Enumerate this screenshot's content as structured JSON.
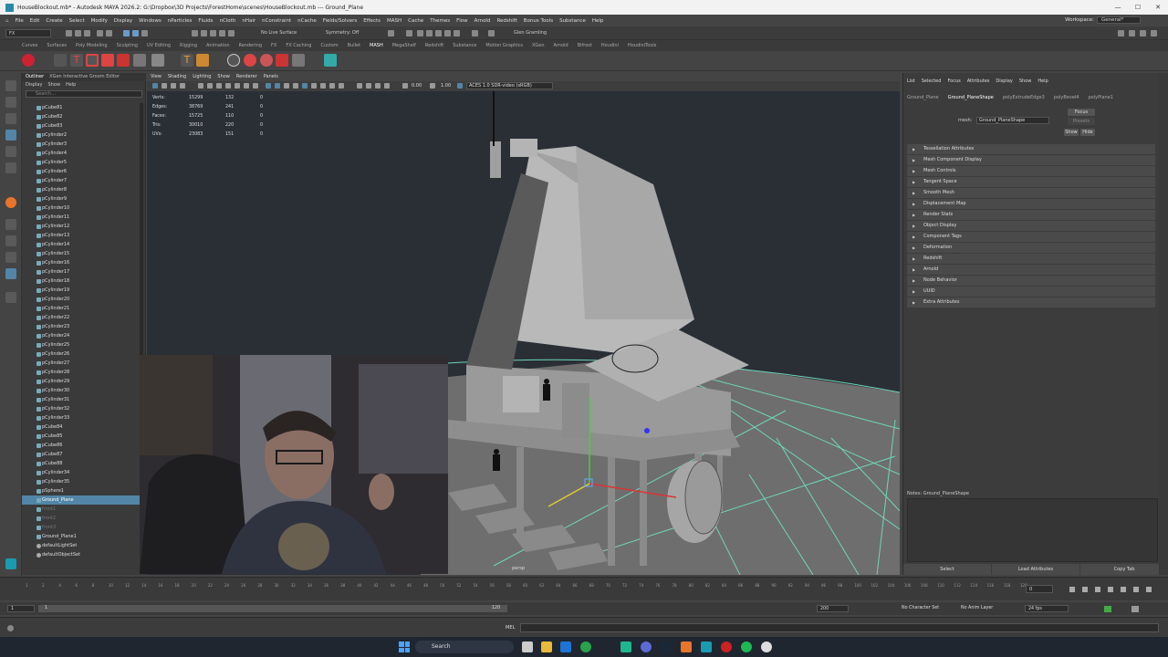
{
  "window": {
    "title": "HouseBlockout.mb* - Autodesk MAYA 2026.2: G:\\Dropbox\\3D Projects\\ForestHome\\scenes\\HouseBlockout.mb   ---   Ground_Plane",
    "controls": [
      "—",
      "☐",
      "✕"
    ]
  },
  "menubar": {
    "items": [
      "File",
      "Edit",
      "Create",
      "Select",
      "Modify",
      "Display",
      "Windows",
      "nParticles",
      "Fluids",
      "nCloth",
      "nHair",
      "nConstraint",
      "nCache",
      "Fields/Solvers",
      "Effects",
      "MASH",
      "Cache",
      "Themes",
      "Flow",
      "Arnold",
      "Redshift",
      "Bonus Tools",
      "Substance",
      "Help"
    ],
    "workspace_label": "Workspace:",
    "workspace_value": "General*"
  },
  "statusline": {
    "mode": "FX",
    "live_surface": "No Live Surface",
    "symmetry": "Symmetry: Off",
    "user": "Glen Gramling"
  },
  "shelf_tabs": {
    "items": [
      "Curves",
      "Surfaces",
      "Poly Modeling",
      "Sculpting",
      "UV Editing",
      "Rigging",
      "Animation",
      "Rendering",
      "FX",
      "FX Caching",
      "Custom",
      "Bullet",
      "MASH",
      "MegaShelf",
      "Redshift",
      "Substance",
      "Motion Graphics",
      "XGen",
      "Arnold",
      "Bifrost",
      "Houdini",
      "HoudiniTools"
    ],
    "active": "MASH"
  },
  "outliner": {
    "tabs": [
      "Outliner",
      "XGen Interactive Groom Editor"
    ],
    "menus": [
      "Display",
      "Show",
      "Help"
    ],
    "search_placeholder": "Search...",
    "items": [
      {
        "label": "pCube81",
        "kind": "mesh"
      },
      {
        "label": "pCube82",
        "kind": "mesh"
      },
      {
        "label": "pCube83",
        "kind": "mesh"
      },
      {
        "label": "pCylinder2",
        "kind": "mesh"
      },
      {
        "label": "pCylinder3",
        "kind": "mesh"
      },
      {
        "label": "pCylinder4",
        "kind": "mesh"
      },
      {
        "label": "pCylinder5",
        "kind": "mesh"
      },
      {
        "label": "pCylinder6",
        "kind": "mesh"
      },
      {
        "label": "pCylinder7",
        "kind": "mesh"
      },
      {
        "label": "pCylinder8",
        "kind": "mesh"
      },
      {
        "label": "pCylinder9",
        "kind": "mesh"
      },
      {
        "label": "pCylinder10",
        "kind": "mesh"
      },
      {
        "label": "pCylinder11",
        "kind": "mesh"
      },
      {
        "label": "pCylinder12",
        "kind": "mesh"
      },
      {
        "label": "pCylinder13",
        "kind": "mesh"
      },
      {
        "label": "pCylinder14",
        "kind": "mesh"
      },
      {
        "label": "pCylinder15",
        "kind": "mesh"
      },
      {
        "label": "pCylinder16",
        "kind": "mesh"
      },
      {
        "label": "pCylinder17",
        "kind": "mesh"
      },
      {
        "label": "pCylinder18",
        "kind": "mesh"
      },
      {
        "label": "pCylinder19",
        "kind": "mesh"
      },
      {
        "label": "pCylinder20",
        "kind": "mesh"
      },
      {
        "label": "pCylinder21",
        "kind": "mesh"
      },
      {
        "label": "pCylinder22",
        "kind": "mesh"
      },
      {
        "label": "pCylinder23",
        "kind": "mesh"
      },
      {
        "label": "pCylinder24",
        "kind": "mesh"
      },
      {
        "label": "pCylinder25",
        "kind": "mesh"
      },
      {
        "label": "pCylinder26",
        "kind": "mesh"
      },
      {
        "label": "pCylinder27",
        "kind": "mesh"
      },
      {
        "label": "pCylinder28",
        "kind": "mesh"
      },
      {
        "label": "pCylinder29",
        "kind": "mesh"
      },
      {
        "label": "pCylinder30",
        "kind": "mesh"
      },
      {
        "label": "pCylinder31",
        "kind": "mesh"
      },
      {
        "label": "pCylinder32",
        "kind": "mesh"
      },
      {
        "label": "pCylinder33",
        "kind": "mesh"
      },
      {
        "label": "pCube84",
        "kind": "mesh"
      },
      {
        "label": "pCube85",
        "kind": "mesh"
      },
      {
        "label": "pCube86",
        "kind": "mesh"
      },
      {
        "label": "pCube87",
        "kind": "mesh"
      },
      {
        "label": "pCube88",
        "kind": "mesh"
      },
      {
        "label": "pCylinder34",
        "kind": "mesh"
      },
      {
        "label": "pCylinder35",
        "kind": "mesh"
      },
      {
        "label": "pSphere1",
        "kind": "mesh"
      },
      {
        "label": "Ground_Plane",
        "kind": "mesh",
        "selected": true
      },
      {
        "label": "front1",
        "kind": "dim"
      },
      {
        "label": "front2",
        "kind": "dim"
      },
      {
        "label": "front3",
        "kind": "dim"
      },
      {
        "label": "Ground_Plane1",
        "kind": "mesh"
      },
      {
        "label": "defaultLightSet",
        "kind": "set"
      },
      {
        "label": "defaultObjectSet",
        "kind": "set"
      }
    ]
  },
  "viewport": {
    "menus": [
      "View",
      "Shading",
      "Lighting",
      "Show",
      "Renderer",
      "Panels"
    ],
    "exposure": "0.00",
    "gamma": "1.00",
    "colorspace": "ACES 1.0 SDR-video (sRGB)",
    "hud": [
      {
        "label": "Verts:",
        "v1": "15299",
        "v2": "132",
        "v3": "0"
      },
      {
        "label": "Edges:",
        "v1": "38769",
        "v2": "241",
        "v3": "0"
      },
      {
        "label": "Faces:",
        "v1": "15725",
        "v2": "110",
        "v3": "0"
      },
      {
        "label": "Tris:",
        "v1": "30010",
        "v2": "220",
        "v3": "0"
      },
      {
        "label": "UVs:",
        "v1": "23083",
        "v2": "151",
        "v3": "0"
      }
    ],
    "camera": "persp"
  },
  "attribute_editor": {
    "menus": [
      "List",
      "Selected",
      "Focus",
      "Attributes",
      "Display",
      "Show",
      "Help"
    ],
    "tabs": [
      "Ground_Plane",
      "Ground_PlaneShape",
      "polyExtrudeEdge3",
      "polyBevel4",
      "polyPlane1"
    ],
    "active_tab": "Ground_PlaneShape",
    "mesh_label": "mesh:",
    "mesh_value": "Ground_PlaneShape",
    "focus_btn": "Focus",
    "presets_btn": "Presets",
    "show_btn": "Show",
    "hide_btn": "Hide",
    "sections": [
      "Tessellation Attributes",
      "Mesh Component Display",
      "Mesh Controls",
      "Tangent Space",
      "Smooth Mesh",
      "Displacement Map",
      "Render Stats",
      "Object Display",
      "Component Tags",
      "Deformation",
      "Redshift",
      "Arnold",
      "Node Behavior",
      "UUID",
      "Extra Attributes"
    ],
    "notes_label": "Notes:  Ground_PlaneShape",
    "bottom_buttons": [
      "Select",
      "Load Attributes",
      "Copy Tab"
    ]
  },
  "timeline": {
    "ticks": [
      "1",
      "2",
      "4",
      "6",
      "8",
      "10",
      "12",
      "14",
      "16",
      "18",
      "20",
      "22",
      "24",
      "26",
      "28",
      "30",
      "32",
      "34",
      "36",
      "38",
      "40",
      "42",
      "44",
      "46",
      "48",
      "50",
      "52",
      "54",
      "56",
      "58",
      "60",
      "62",
      "64",
      "66",
      "68",
      "70",
      "72",
      "74",
      "76",
      "78",
      "80",
      "82",
      "84",
      "86",
      "88",
      "90",
      "92",
      "94",
      "96",
      "98",
      "100",
      "102",
      "104",
      "106",
      "108",
      "110",
      "112",
      "114",
      "116",
      "118",
      "120"
    ],
    "current_frame": "0"
  },
  "range": {
    "start": "1",
    "start2": "1",
    "end_inner": "120",
    "end_outer": "200",
    "character_set": "No Character Set",
    "anim_layer": "No Anim Layer",
    "fps": "24 fps"
  },
  "command_line": {
    "lang": "MEL"
  },
  "taskbar": {
    "search": "Search"
  }
}
